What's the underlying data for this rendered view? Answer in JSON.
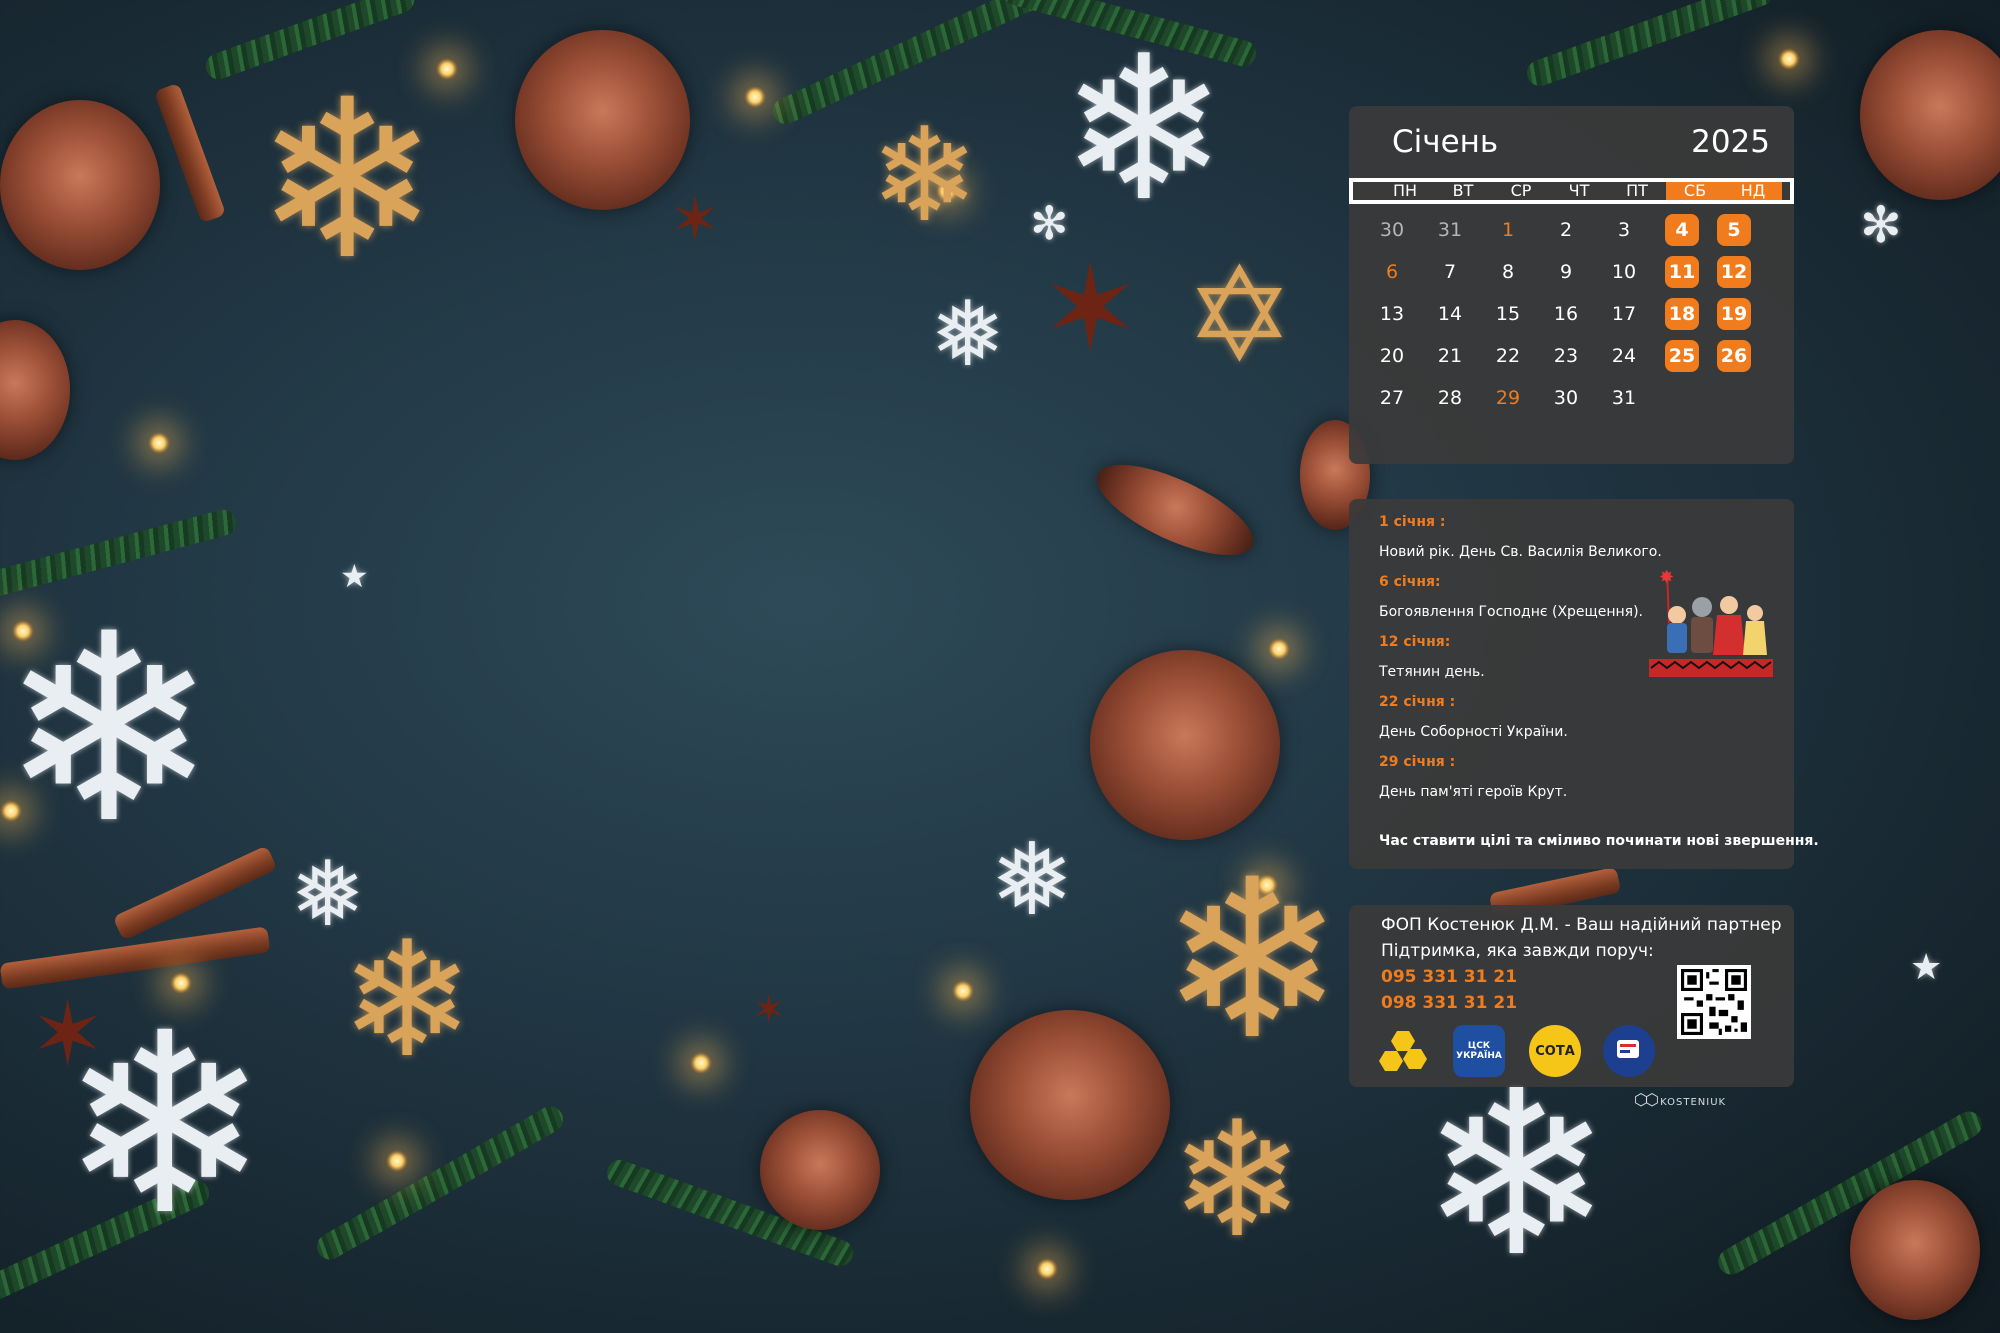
{
  "calendar": {
    "month": "Січень",
    "year": "2025",
    "weekdays": [
      "ПН",
      "ВТ",
      "СР",
      "ЧТ",
      "ПТ",
      "СБ",
      "НД"
    ],
    "weeks": [
      [
        "30",
        "31",
        "1",
        "2",
        "3",
        "4",
        "5"
      ],
      [
        "6",
        "7",
        "8",
        "9",
        "10",
        "11",
        "12"
      ],
      [
        "13",
        "14",
        "15",
        "16",
        "17",
        "18",
        "19"
      ],
      [
        "20",
        "21",
        "22",
        "23",
        "24",
        "25",
        "26"
      ],
      [
        "27",
        "28",
        "29",
        "30",
        "31",
        "",
        ""
      ]
    ],
    "muted_days": [
      "30",
      "31"
    ],
    "holiday_days": [
      "1",
      "6",
      "29"
    ],
    "accent_color": "#f07c1e"
  },
  "holidays": [
    {
      "date": "1 січня :",
      "name": "Новий рік.  День Св. Василія Великого."
    },
    {
      "date": "6 січня:",
      "name": "Богоявлення Господнє (Хрещення)."
    },
    {
      "date": "12 січня:",
      "name": "Тетянин день."
    },
    {
      "date": "22 січня :",
      "name": "День Соборності України."
    },
    {
      "date": "29 січня :",
      "name": "День пам'яті героїв Крут."
    }
  ],
  "motto": "Час ставити цілі та сміливо починати нові звершення.",
  "contact": {
    "line1": "ФОП Костенюк Д.М. - Ваш надійний партнер",
    "line2": "Підтримка, яка завжди поруч:",
    "phone1": "095 331 31 21",
    "phone2": "098 331 31 21"
  },
  "logos": [
    {
      "icon": "honeycomb-logo-icon",
      "text": ""
    },
    {
      "icon": "shield-logo-icon",
      "text": "ЦСК УКРАЇНА"
    },
    {
      "icon": "sota-logo-icon",
      "text": "СОТА"
    },
    {
      "icon": "document-logo-icon",
      "text": ""
    }
  ],
  "brand": "KOSTENIUK"
}
